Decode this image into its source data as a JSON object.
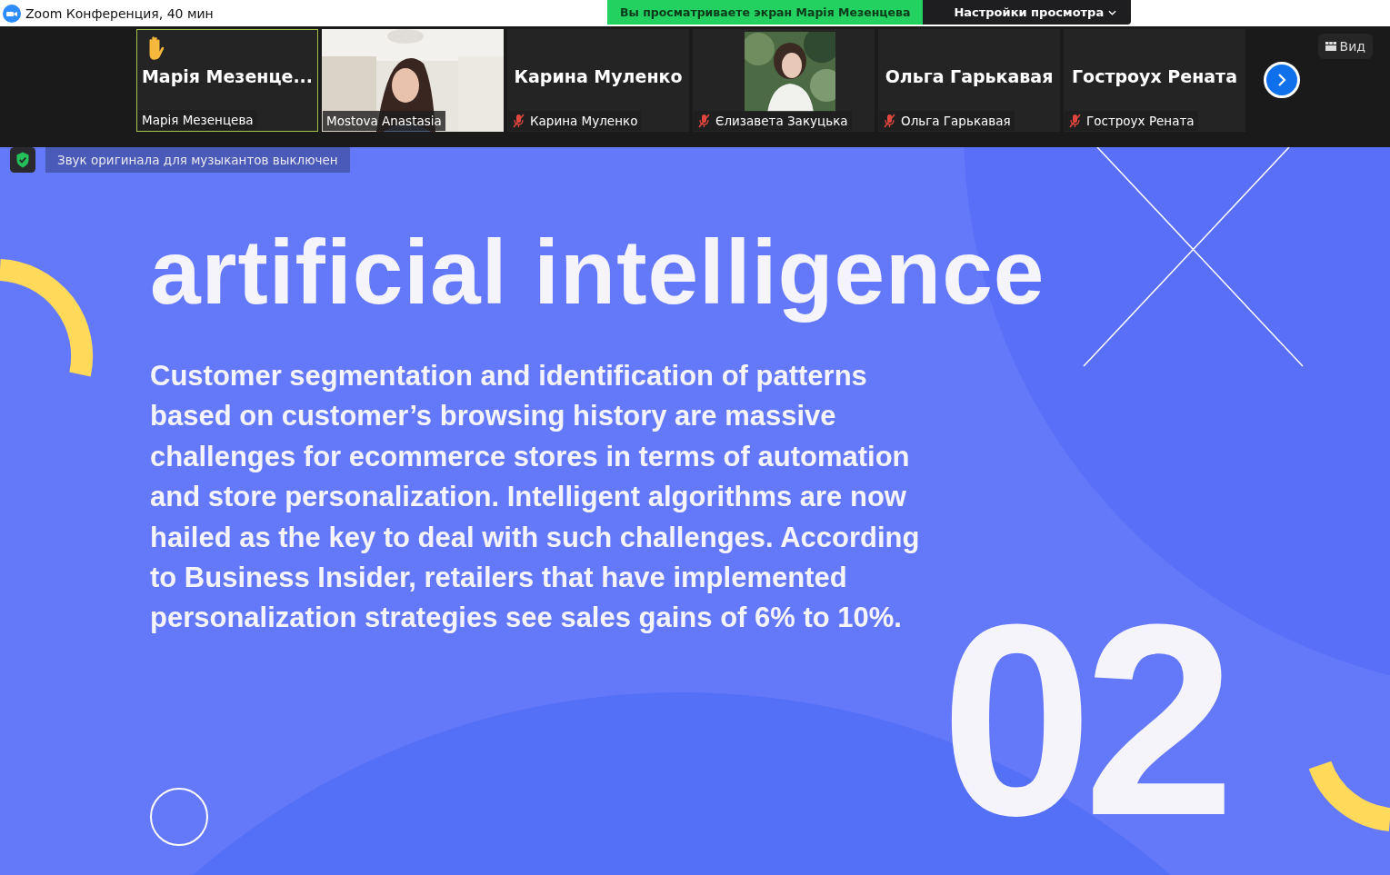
{
  "window": {
    "title": "Zoom Конференция, 40 мин"
  },
  "share_banner": {
    "text": "Вы просматриваете экран Марія Мезенцева"
  },
  "view_settings": {
    "label": "Настройки просмотра"
  },
  "participants": [
    {
      "kind": "avatar",
      "display_name": "Марія  Мезенце...",
      "name_label": "Марія Мезенцева",
      "muted": false,
      "hand_raised": true,
      "speaking": true
    },
    {
      "kind": "video",
      "name_label": "Mostova Anastasia",
      "muted": false,
      "hand_raised": false,
      "speaking": false
    },
    {
      "kind": "avatar",
      "display_name": "Карина Муленко",
      "name_label": "Карина Муленко",
      "muted": true,
      "hand_raised": false,
      "speaking": false
    },
    {
      "name_label": "Єлизавета Закуцька",
      "muted": true,
      "hand_raised": false,
      "speaking": false
    },
    {
      "kind": "avatar",
      "display_name": "Ольга Гарькавая",
      "name_label": "Ольга Гарькавая",
      "muted": true,
      "hand_raised": false,
      "speaking": false
    },
    {
      "kind": "avatar",
      "display_name": "Гостроух Рената",
      "name_label": "Гостроух Рената",
      "muted": true,
      "hand_raised": false,
      "speaking": false
    }
  ],
  "view_button": {
    "label": "Вид"
  },
  "notice": {
    "text": "Звук оригинала для музыкантов выключен"
  },
  "slide": {
    "title": "artificial intelligence",
    "body": "Customer segmentation and identification of patterns based on customer’s browsing history are massive challenges for ecommerce stores in terms of automation and store personalization. Intelligent algorithms are now hailed as the key to deal with such challenges. According to Business Insider, retailers that have implemented personalization strategies see sales gains of 6% to 10%.",
    "number": "02"
  }
}
